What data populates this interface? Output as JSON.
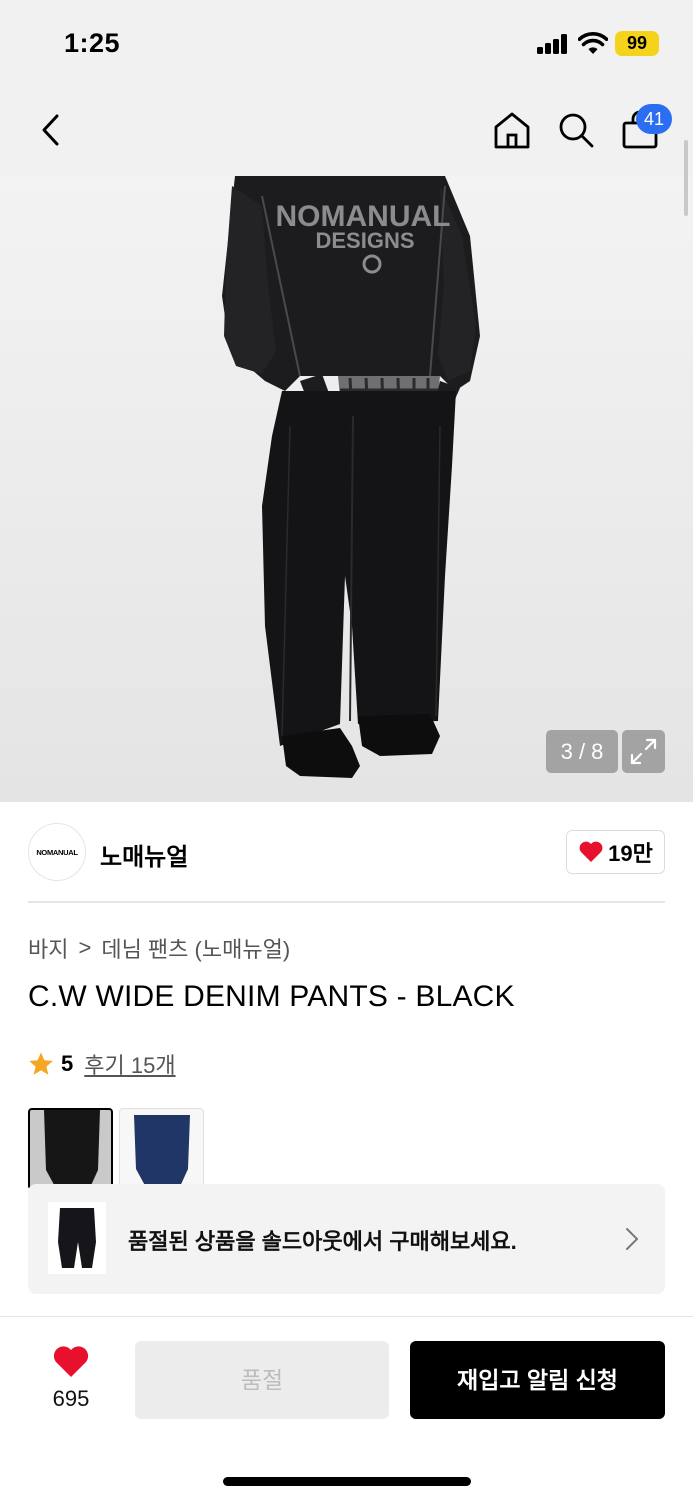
{
  "status_bar": {
    "time": "1:25",
    "battery": "99"
  },
  "header": {
    "cart_count": "41"
  },
  "gallery": {
    "counter": "3 / 8",
    "sweater_text_line1": "NOMANUAL",
    "sweater_text_line2": "DESIGNS"
  },
  "brand": {
    "logo_text": "NOMANUAL",
    "name": "노매뉴얼",
    "likes": "19만"
  },
  "breadcrumb": {
    "category": "바지",
    "separator": ">",
    "subcategory": "데님 팬츠 (노매뉴얼)"
  },
  "product": {
    "title": "C.W WIDE DENIM PANTS - BLACK",
    "rating": "5",
    "reviews": "후기 15개"
  },
  "swatches": [
    {
      "color": "#1a1a1a",
      "selected": true
    },
    {
      "color": "#1f3666",
      "selected": false
    }
  ],
  "soldout_banner": {
    "text": "품절된 상품을 솔드아웃에서 구매해보세요."
  },
  "bottom_bar": {
    "like_count": "695",
    "soldout_label": "품절",
    "notify_label": "재입고 알림 신청"
  },
  "colors": {
    "accent_blue": "#2c6ef2",
    "heart_red": "#e8112d",
    "star_orange": "#f5a623",
    "battery_yellow": "#f6d31b"
  }
}
